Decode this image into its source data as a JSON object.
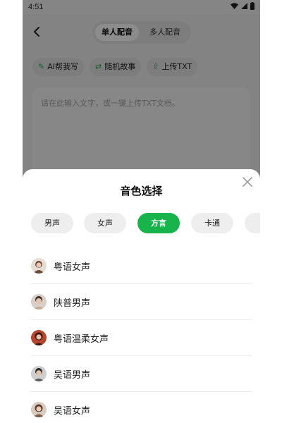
{
  "status": {
    "time": "4:51"
  },
  "header": {
    "tabs": [
      {
        "label": "单人配音",
        "active": true
      },
      {
        "label": "多人配音",
        "active": false
      }
    ]
  },
  "tools": [
    {
      "label": "AI帮我写",
      "icon": "magic-wand-icon"
    },
    {
      "label": "随机故事",
      "icon": "shuffle-icon"
    },
    {
      "label": "上传TXT",
      "icon": "upload-icon"
    }
  ],
  "editor": {
    "placeholder": "请在此输入文字，或一键上传TXT文档。"
  },
  "sheet": {
    "title": "音色选择",
    "categories": [
      {
        "label": "男声",
        "active": false
      },
      {
        "label": "女声",
        "active": false
      },
      {
        "label": "方言",
        "active": true
      },
      {
        "label": "卡通",
        "active": false
      },
      {
        "label": "儿",
        "active": false
      }
    ],
    "voices": [
      {
        "label": "粤语女声",
        "avatar_color": "#6b4a3a"
      },
      {
        "label": "陕普男声",
        "avatar_color": "#c9a58f"
      },
      {
        "label": "粤语温柔女声",
        "avatar_color": "#b5452f"
      },
      {
        "label": "吴语男声",
        "avatar_color": "#5a5a5a"
      },
      {
        "label": "吴语女声",
        "avatar_color": "#7a5a48"
      }
    ]
  },
  "colors": {
    "accent": "#18b34b"
  }
}
